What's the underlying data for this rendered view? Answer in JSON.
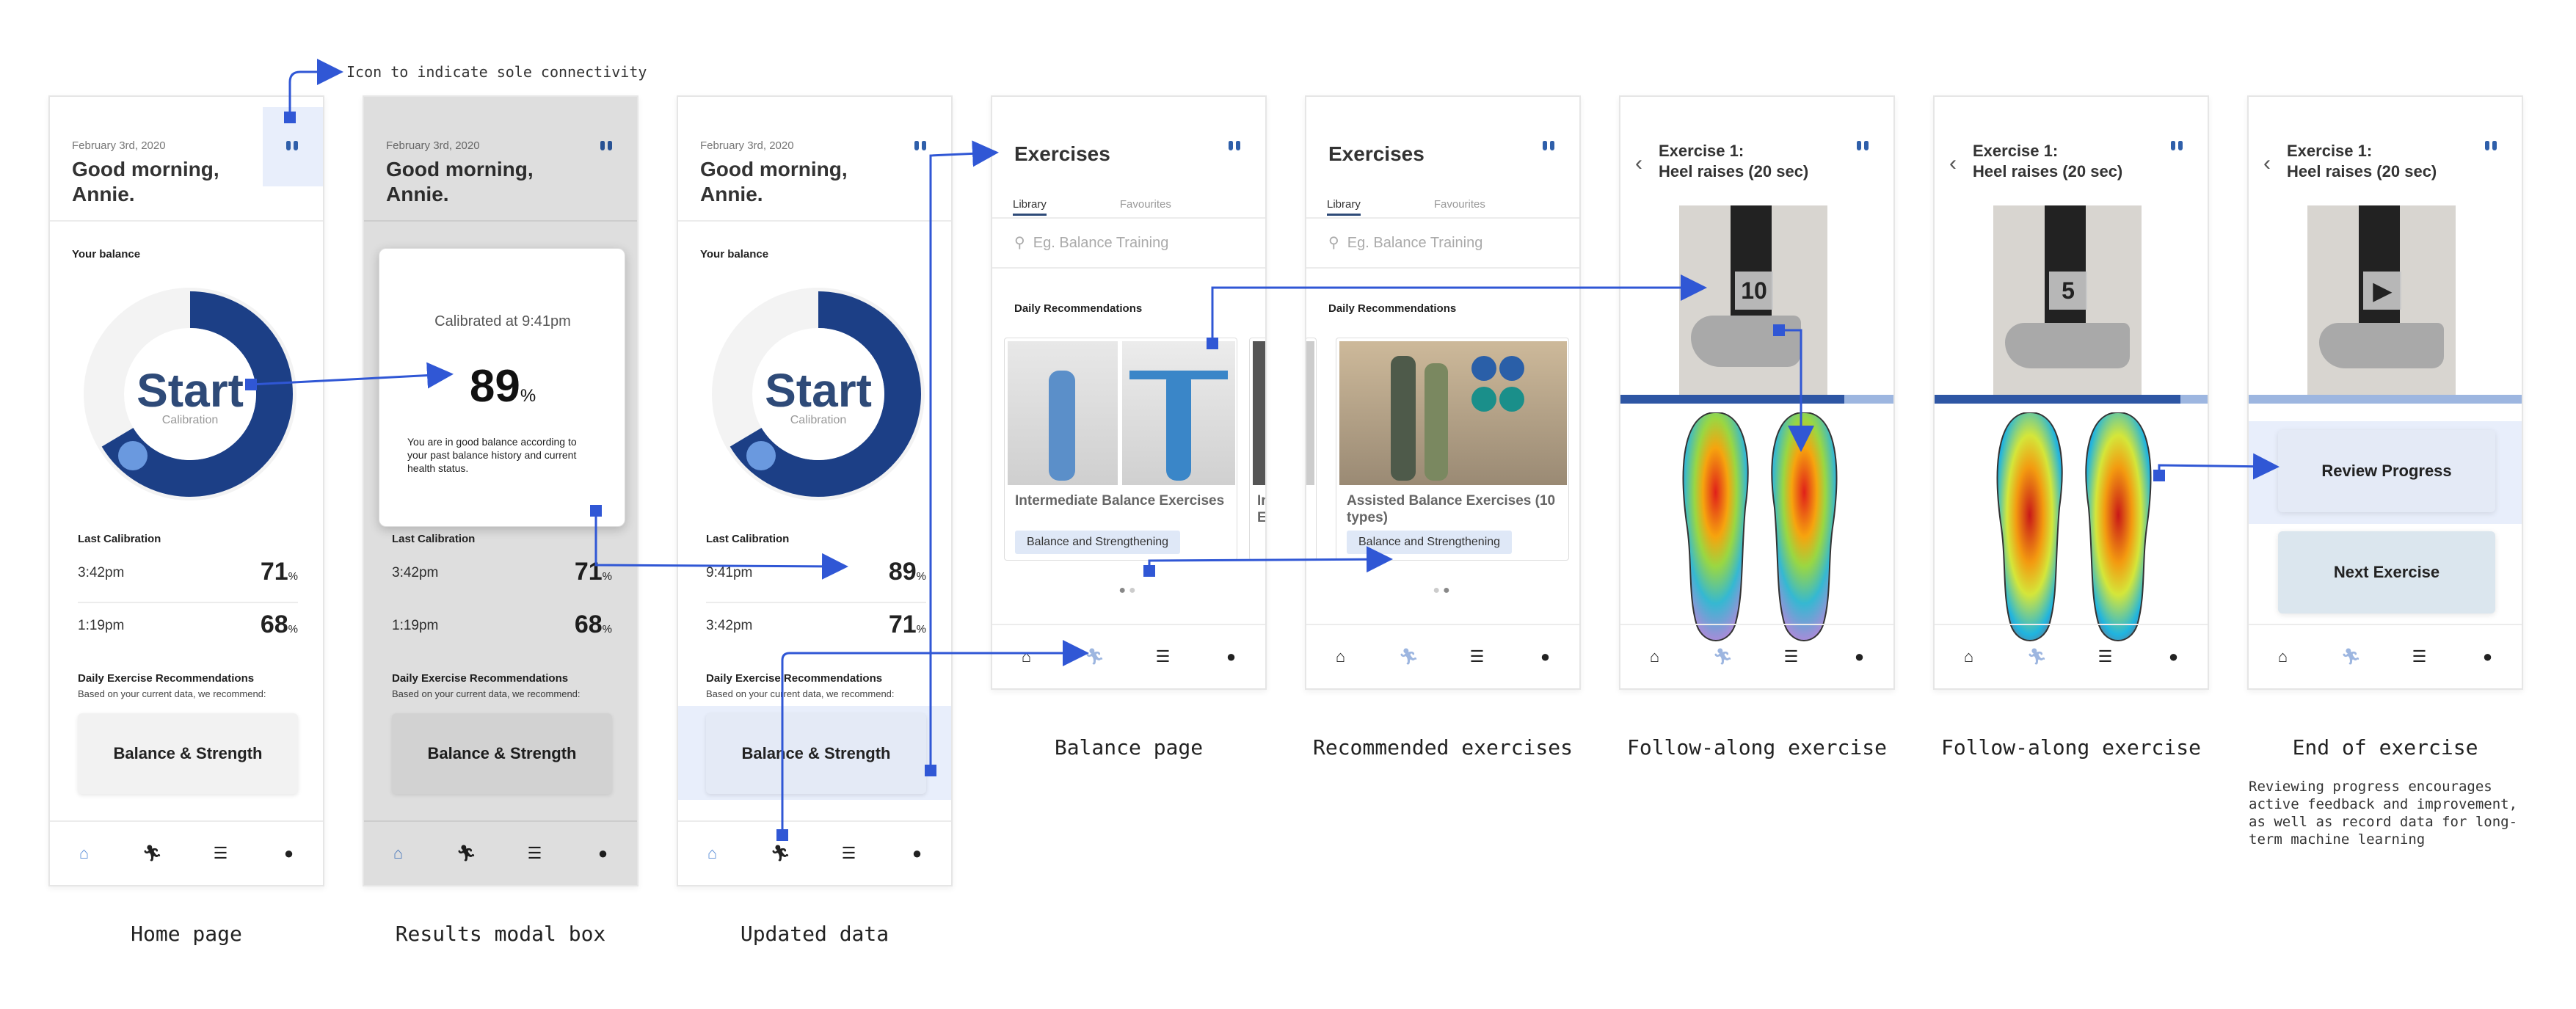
{
  "annotation_top": "Icon to indicate sole connectivity",
  "nav_icons": [
    "home-icon",
    "exercise-runner-icon",
    "list-icon",
    "profile-icon"
  ],
  "accent": "#3057d5",
  "home": {
    "date": "February 3rd, 2020",
    "greeting": "Good morning, Annie.",
    "your_balance": "Your balance",
    "ring_start": "Start",
    "ring_sub": "Calibration",
    "last_calibration": "Last Calibration",
    "rows": [
      {
        "time": "3:42pm",
        "value": "71",
        "unit": "%"
      },
      {
        "time": "1:19pm",
        "value": "68",
        "unit": "%"
      }
    ],
    "rec_title": "Daily Exercise Recommendations",
    "rec_sub": "Based on your current data, we recommend:",
    "rec_button": "Balance & Strength",
    "caption": "Home page"
  },
  "modal": {
    "calibrated": "Calibrated at 9:41pm",
    "value": "89",
    "unit": "%",
    "message": "You are in good balance according to your past balance history and current health status.",
    "caption": "Results modal box"
  },
  "updated": {
    "rows": [
      {
        "time": "9:41pm",
        "value": "89",
        "unit": "%"
      },
      {
        "time": "3:42pm",
        "value": "71",
        "unit": "%"
      }
    ],
    "caption": "Updated data"
  },
  "exercises": {
    "title": "Exercises",
    "tab_library": "Library",
    "tab_favourites": "Favourites",
    "search_placeholder": "Eg. Balance Training",
    "daily_rec": "Daily Recommendations",
    "card1_title": "Intermediate Balance Exercises",
    "card1_partial": "Ir E",
    "card2_title": "Assisted Balance Exercises (10 types)",
    "card_tag": "Balance and Strengthening",
    "caption_balance": "Balance page",
    "caption_recommended": "Recommended exercises"
  },
  "follow": {
    "title_line1": "Exercise 1:",
    "title_line2": "Heel raises (20 sec)",
    "count_a": "10",
    "count_b": "5",
    "progress_a": 0.82,
    "progress_b": 0.9,
    "caption": "Follow-along exercise"
  },
  "end": {
    "review": "Review Progress",
    "next": "Next Exercise",
    "caption": "End of exercise",
    "note": "Reviewing progress encourages active feedback and improvement, as well as record data for long-term machine learning"
  }
}
